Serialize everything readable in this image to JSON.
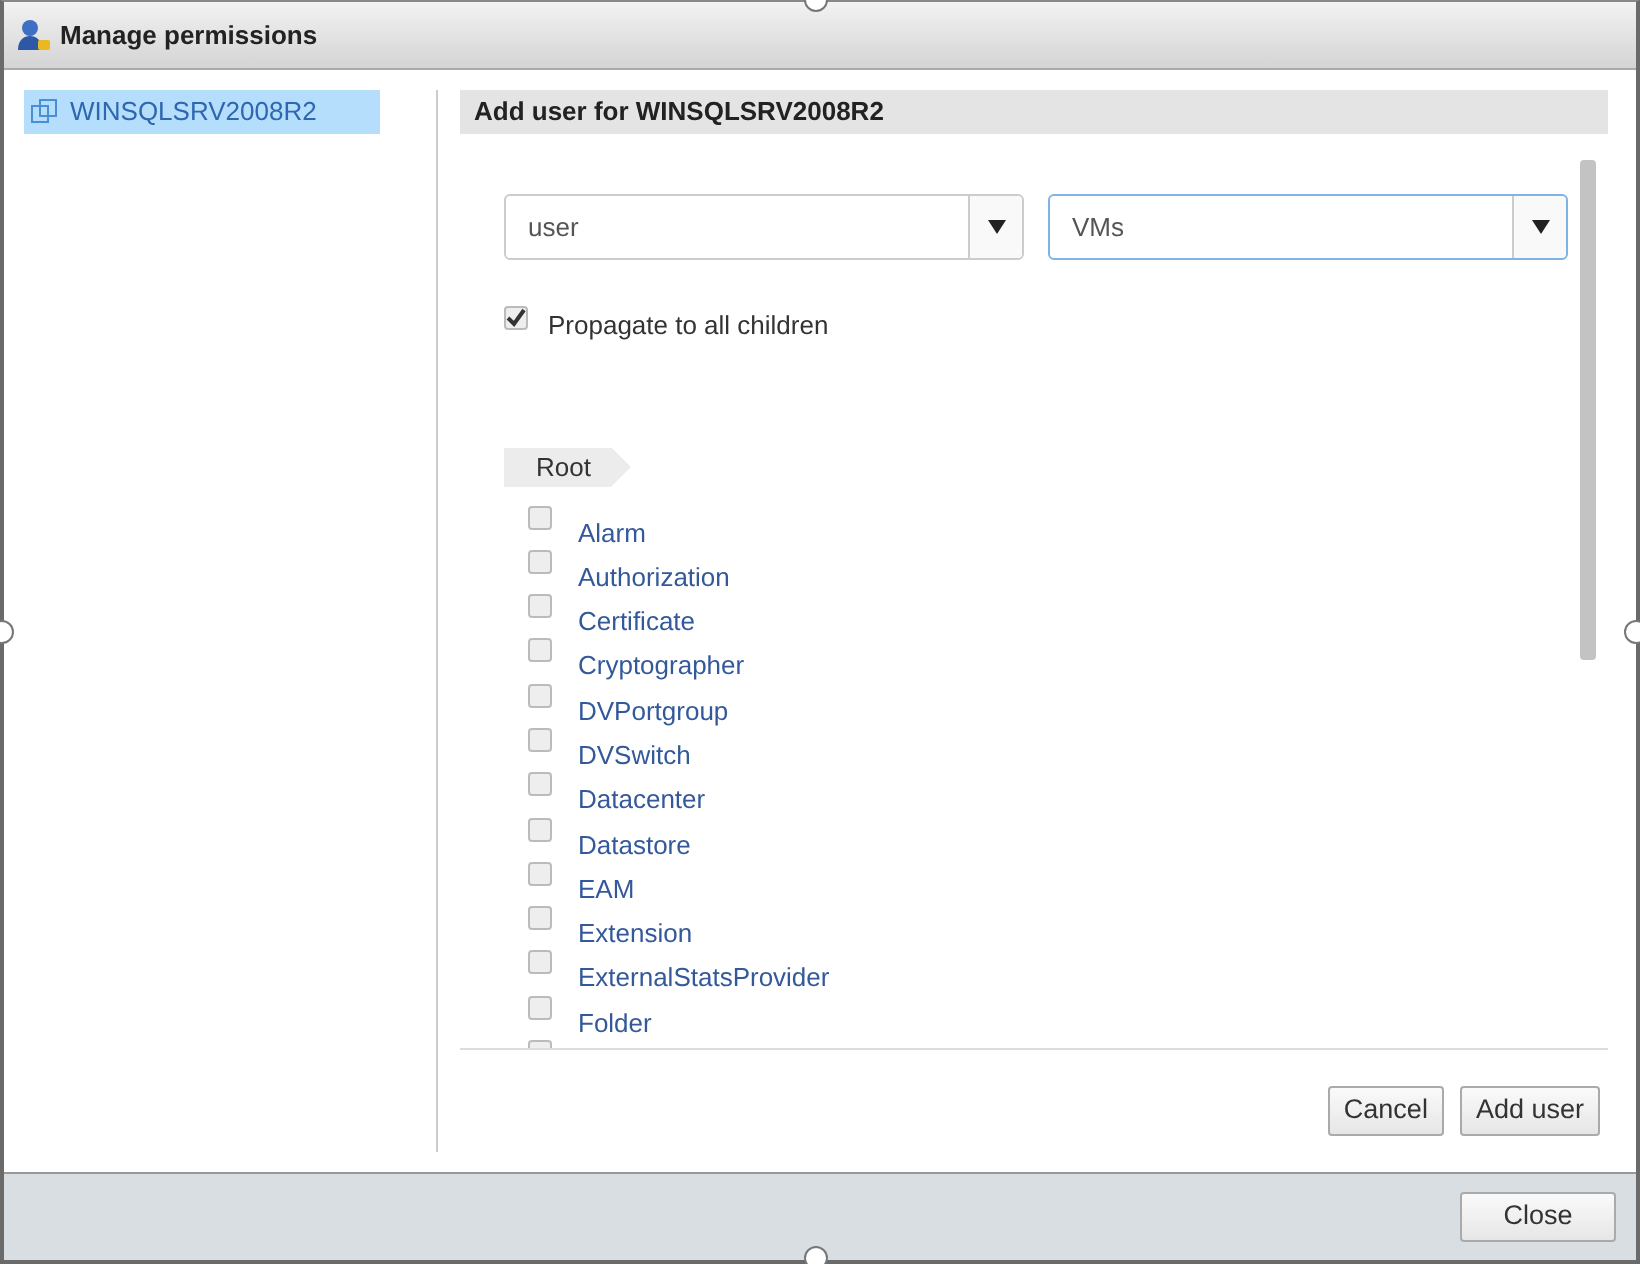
{
  "window": {
    "title": "Manage permissions"
  },
  "tree": [
    {
      "label": "WINSQLSRV2008R2",
      "selected": true
    }
  ],
  "panel": {
    "title": "Add user for WINSQLSRV2008R2",
    "fields": [
      {
        "value": "user",
        "focused": false
      },
      {
        "value": "VMs",
        "focused": true
      }
    ],
    "propagate": {
      "label": "Propagate to all children",
      "checked": true
    },
    "breadcrumb": "Root",
    "privileges": [
      {
        "label": "Alarm",
        "checked": false
      },
      {
        "label": "Authorization",
        "checked": false
      },
      {
        "label": "Certificate",
        "checked": false
      },
      {
        "label": "Cryptographer",
        "checked": false
      },
      {
        "label": "DVPortgroup",
        "checked": false
      },
      {
        "label": "DVSwitch",
        "checked": false
      },
      {
        "label": "Datacenter",
        "checked": false
      },
      {
        "label": "Datastore",
        "checked": false
      },
      {
        "label": "EAM",
        "checked": false
      },
      {
        "label": "Extension",
        "checked": false
      },
      {
        "label": "ExternalStatsProvider",
        "checked": false
      },
      {
        "label": "Folder",
        "checked": false
      },
      {
        "checked": false
      }
    ],
    "buttons": [
      "Cancel",
      "Add user"
    ]
  },
  "footer": {
    "buttons": [
      "Close"
    ]
  }
}
